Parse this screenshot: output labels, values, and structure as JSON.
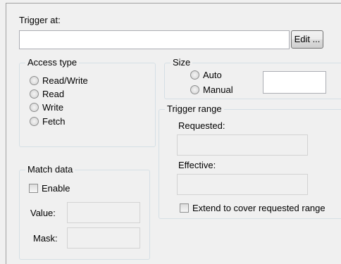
{
  "trigger": {
    "label": "Trigger at:",
    "value": "",
    "edit_button": "Edit ..."
  },
  "access_type": {
    "title": "Access type",
    "options": [
      "Read/Write",
      "Read",
      "Write",
      "Fetch"
    ]
  },
  "size": {
    "title": "Size",
    "options": [
      "Auto",
      "Manual"
    ],
    "value": ""
  },
  "trigger_range": {
    "title": "Trigger range",
    "requested_label": "Requested:",
    "requested_value": "",
    "effective_label": "Effective:",
    "effective_value": "",
    "extend_label": "Extend to cover requested range"
  },
  "match_data": {
    "title": "Match data",
    "enable_label": "Enable",
    "value_label": "Value:",
    "value": "",
    "mask_label": "Mask:",
    "mask": ""
  }
}
